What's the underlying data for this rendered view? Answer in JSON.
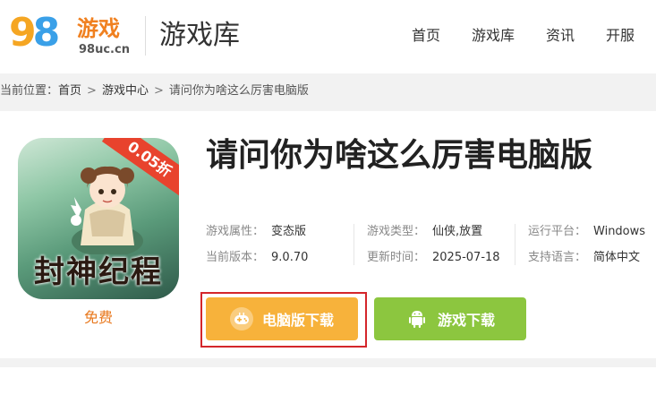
{
  "header": {
    "logo": {
      "digits": "98",
      "brand": "游戏",
      "domain": "98uc.cn"
    },
    "section_title": "游戏库",
    "nav": [
      {
        "label": "首页"
      },
      {
        "label": "游戏库"
      },
      {
        "label": "资讯"
      },
      {
        "label": "开服"
      }
    ]
  },
  "breadcrumb": {
    "prefix": "当前位置：",
    "items": [
      "首页",
      "游戏中心",
      "请问你为啥这么厉害电脑版"
    ],
    "separator": ">"
  },
  "game": {
    "title": "请问你为啥这么厉害电脑版",
    "icon": {
      "name": "game-cover-icon",
      "text": "封神纪程",
      "discount": "0.05折"
    },
    "price_label": "免费",
    "attributes": [
      {
        "key": "游戏属性：",
        "value": "变态版"
      },
      {
        "key": "游戏类型：",
        "value": "仙侠,放置"
      },
      {
        "key": "运行平台：",
        "value": "Windows"
      },
      {
        "key": "当前版本：",
        "value": "9.0.70"
      },
      {
        "key": "更新时间：",
        "value": "2025-07-18"
      },
      {
        "key": "支持语言：",
        "value": "简体中文"
      }
    ],
    "buttons": {
      "pc_download": {
        "label": "电脑版下载",
        "icon": "gamepad-icon"
      },
      "game_download": {
        "label": "游戏下载",
        "icon": "android-icon"
      }
    }
  },
  "colors": {
    "pc_button": "#f7b23b",
    "game_button": "#8cc63f",
    "highlight_border": "#d4262b",
    "free_label": "#e8781d",
    "discount_ribbon": "#e8432d"
  }
}
